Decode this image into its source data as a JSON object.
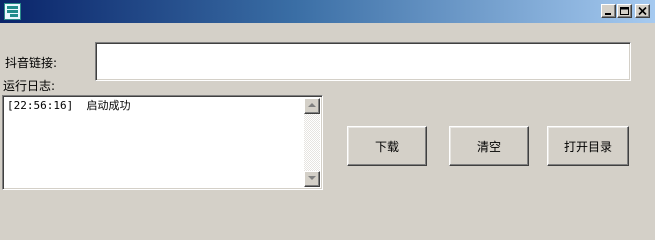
{
  "window": {
    "icon": "app-logo-icon",
    "controls": [
      "minimize-icon",
      "maximize-icon",
      "close-icon"
    ]
  },
  "form": {
    "link_label": "抖音链接:",
    "link_value": "",
    "log_label": "运行日志:",
    "log_lines": [
      "[22:56:16]  启动成功"
    ]
  },
  "buttons": {
    "download": "下载",
    "clear": "清空",
    "open_dir": "打开目录"
  }
}
